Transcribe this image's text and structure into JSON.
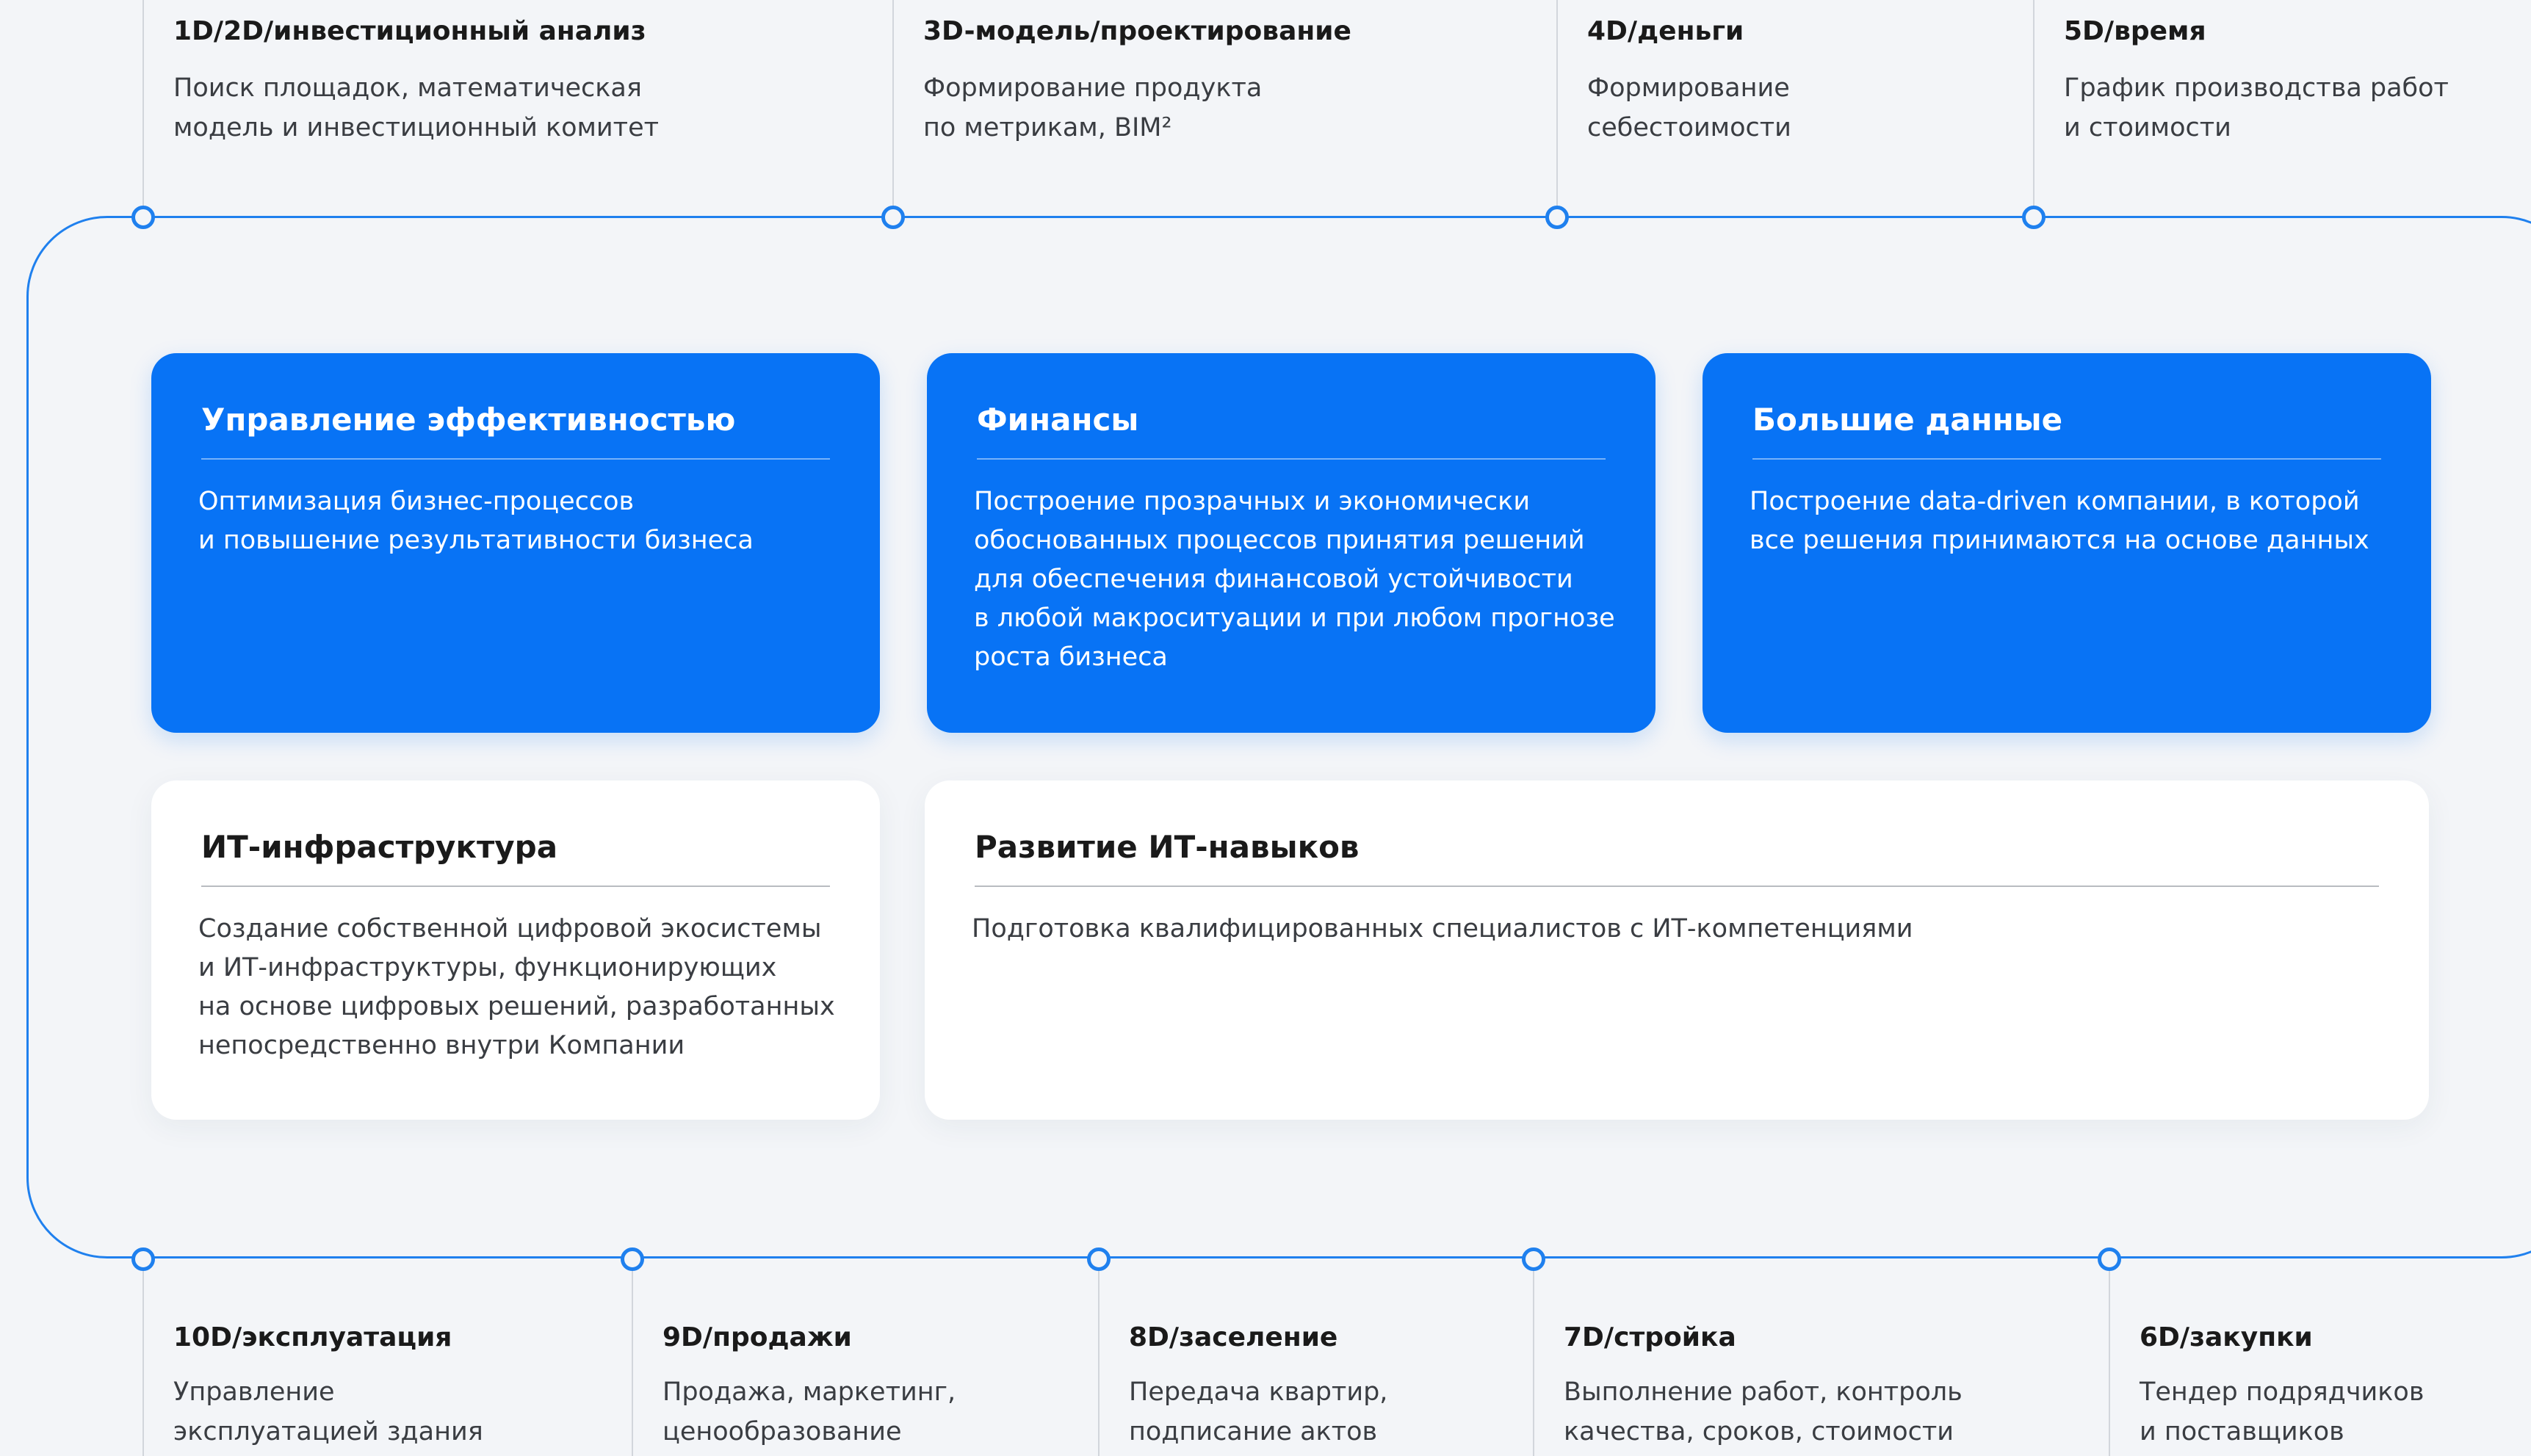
{
  "top_stages": [
    {
      "title": "1D/2D/инвестиционный анализ",
      "desc": "Поиск площадок, математическая\nмодель и инвестиционный комитет"
    },
    {
      "title": "3D-модель/проектирование",
      "desc": "Формирование продукта\nпо метрикам, BIM²"
    },
    {
      "title": "4D/деньги",
      "desc": "Формирование\nсебестоимости"
    },
    {
      "title": "5D/время",
      "desc": "График производства работ\nи стоимости"
    }
  ],
  "bottom_stages": [
    {
      "title": "10D/эксплуатация",
      "desc": "Управление\nэксплуатацией здания"
    },
    {
      "title": "9D/продажи",
      "desc": "Продажа, маркетинг,\nценообразование"
    },
    {
      "title": "8D/заселение",
      "desc": "Передача квартир,\nподписание актов"
    },
    {
      "title": "7D/стройка",
      "desc": "Выполнение работ, контроль\nкачества, сроков, стоимости"
    },
    {
      "title": "6D/закупки",
      "desc": "Тендер подрядчиков\nи поставщиков"
    }
  ],
  "cards": [
    {
      "title": "Управление эффективностью",
      "text": "Оптимизация бизнес-процессов\nи повышение результативности бизнеса"
    },
    {
      "title": "Финансы",
      "text": "Построение прозрачных и экономически\nобоснованных процессов принятия решений\nдля обеспечения финансовой устойчивости\nв любой макроситуации и при любом прогнозе\nроста бизнеса"
    },
    {
      "title": "Большие данные",
      "text": "Построение data-driven компании, в которой\nвсе решения принимаются на основе данных"
    },
    {
      "title": "ИТ-инфраструктура",
      "text": "Создание собственной цифровой экосистемы\nи ИТ-инфраструктуры, функционирующих\nна основе цифровых решений, разработанных\nнепосредственно внутри Компании"
    },
    {
      "title": "Развитие ИТ-навыков",
      "text": "Подготовка квалифицированных специалистов с ИТ-компетенциями"
    }
  ],
  "colors": {
    "accent": "#1f80ee",
    "card_blue": "#0873f5",
    "background": "#f3f5f8",
    "card_white": "#ffffff"
  }
}
